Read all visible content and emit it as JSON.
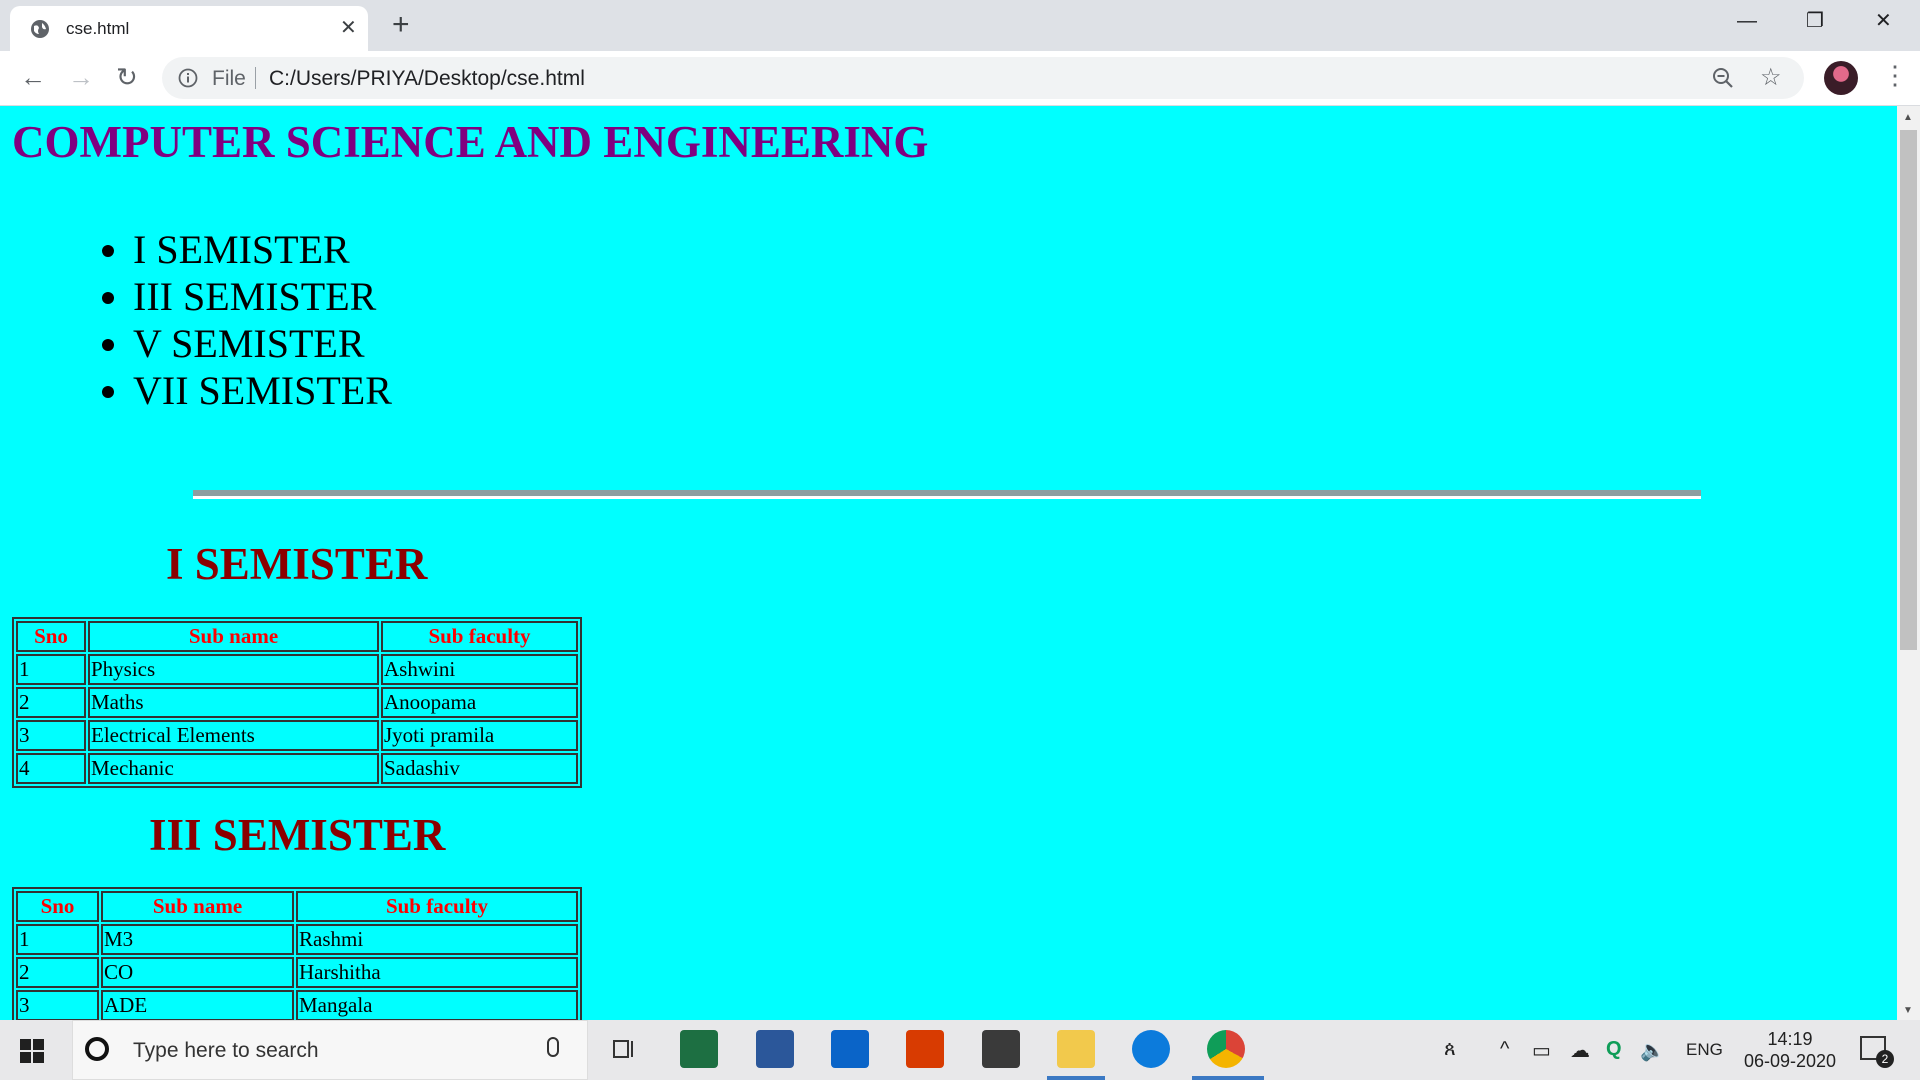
{
  "browser": {
    "tab_title": "cse.html",
    "tab_close": "✕",
    "new_tab": "+",
    "window_controls": {
      "minimize": "—",
      "restore": "❐",
      "close": "✕"
    },
    "nav": {
      "back": "←",
      "forward": "→",
      "reload": "↻"
    },
    "address": {
      "scheme_label": "File",
      "url": "C:/Users/PRIYA/Desktop/cse.html"
    },
    "bookmark_star": "☆",
    "menu_dots": "⋮"
  },
  "page": {
    "title": "COMPUTER SCIENCE AND ENGINEERING",
    "semester_links": [
      "I SEMISTER",
      "III SEMISTER",
      "V SEMISTER",
      "VII SEMISTER"
    ],
    "sections": [
      {
        "heading": "I SEMISTER",
        "headers": [
          "Sno",
          "Sub name",
          "Sub faculty"
        ],
        "rows": [
          [
            "1",
            "Physics",
            "Ashwini"
          ],
          [
            "2",
            "Maths",
            "Anoopama"
          ],
          [
            "3",
            "Electrical Elements",
            "Jyoti pramila"
          ],
          [
            "4",
            "Mechanic",
            "Sadashiv"
          ]
        ]
      },
      {
        "heading": "III SEMISTER",
        "headers": [
          "Sno",
          "Sub name",
          "Sub faculty"
        ],
        "rows": [
          [
            "1",
            "M3",
            "Rashmi"
          ],
          [
            "2",
            "CO",
            "Harshitha"
          ],
          [
            "3",
            "ADE",
            "Mangala"
          ]
        ]
      }
    ]
  },
  "taskbar": {
    "search_placeholder": "Type here to search",
    "apps": [
      "task-view",
      "excel",
      "word",
      "mail",
      "office",
      "store",
      "file-explorer",
      "edge",
      "chrome"
    ],
    "tray": {
      "language": "ENG"
    },
    "clock": {
      "time": "14:19",
      "date": "06-09-2020"
    },
    "notification_count": "2",
    "colors": {
      "excel": "#1d6f42",
      "word": "#2b579a",
      "mail": "#0a64c8",
      "office": "#d83b01",
      "store": "#3a3a3a",
      "explorer": "#f2c94c",
      "edge": "#0c7bdc",
      "chrome": "#db4437"
    }
  }
}
